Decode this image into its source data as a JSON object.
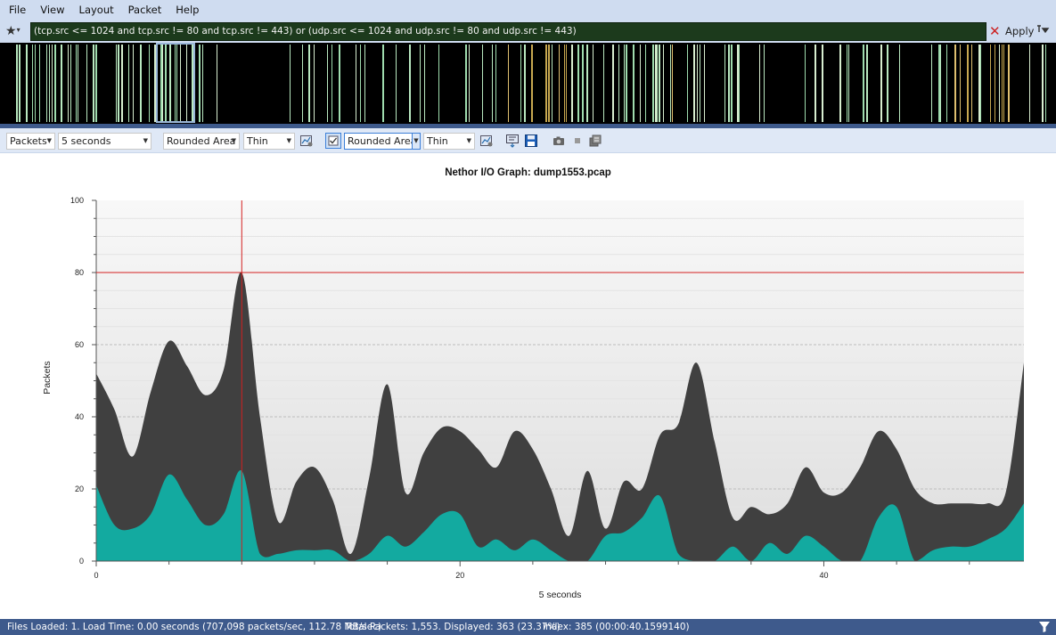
{
  "menu": [
    "File",
    "View",
    "Layout",
    "Packet",
    "Help"
  ],
  "filter": {
    "value": "(tcp.src <= 1024 and tcp.src != 80 and tcp.src != 443) or (udp.src <= 1024 and udp.src != 80 and udp.src != 443)",
    "apply_label": "Apply"
  },
  "toolbar": {
    "units": "Packets",
    "interval": "5 seconds",
    "style1": "Rounded Area",
    "width1": "Thin",
    "style2": "Rounded Area",
    "width2": "Thin"
  },
  "status": {
    "files_loaded": "Files Loaded: 1. Load Time: 0.00 seconds (707,098 packets/sec, 112.78 MB/sec)",
    "total_packets": "Total Packets: 1,553. Displayed: 363 (23.37%)",
    "index": "Index: 385 (00:00:40.1599140)"
  },
  "chart_data": {
    "type": "area",
    "title": "Nethor I/O Graph: dump1553.pcap",
    "xlabel": "5 seconds",
    "ylabel": "Packets",
    "xlim": [
      0,
      51
    ],
    "ylim": [
      0,
      100
    ],
    "x_ticks": [
      0,
      20,
      40
    ],
    "y_ticks": [
      0,
      20,
      40,
      60,
      80,
      100
    ],
    "grid": true,
    "cursor": {
      "x": 8,
      "y": 80
    },
    "series": [
      {
        "color": "#404040",
        "x": [
          0,
          1,
          2,
          3,
          4,
          5,
          6,
          7,
          8,
          9,
          10,
          11,
          12,
          13,
          14,
          15,
          16,
          17,
          18,
          19,
          20,
          21,
          22,
          23,
          24,
          25,
          26,
          27,
          28,
          29,
          30,
          31,
          32,
          33,
          34,
          35,
          36,
          37,
          38,
          39,
          40,
          41,
          42,
          43,
          44,
          45,
          46,
          47,
          48,
          49,
          50,
          51
        ],
        "values": [
          52,
          42,
          29,
          47,
          61,
          54,
          46,
          53,
          80,
          40,
          11,
          22,
          26,
          17,
          2,
          23,
          49,
          19,
          30,
          37,
          36,
          31,
          26,
          36,
          31,
          20,
          7,
          25,
          9,
          22,
          20,
          35,
          38,
          55,
          33,
          12,
          15,
          13,
          16,
          26,
          19,
          19,
          26,
          36,
          31,
          20,
          16,
          16,
          16,
          16,
          19,
          55
        ]
      },
      {
        "color": "#13aaa0",
        "x": [
          0,
          1,
          2,
          3,
          4,
          5,
          6,
          7,
          8,
          9,
          10,
          11,
          12,
          13,
          14,
          15,
          16,
          17,
          18,
          19,
          20,
          21,
          22,
          23,
          24,
          25,
          26,
          27,
          28,
          29,
          30,
          31,
          32,
          33,
          34,
          35,
          36,
          37,
          38,
          39,
          40,
          41,
          42,
          43,
          44,
          45,
          46,
          47,
          48,
          49,
          50,
          51
        ],
        "values": [
          21,
          10,
          9,
          13,
          24,
          17,
          10,
          13,
          25,
          2,
          2,
          3,
          3,
          3,
          0,
          2,
          7,
          4,
          8,
          13,
          13,
          4,
          6,
          3,
          6,
          3,
          0,
          0,
          7,
          8,
          12,
          18,
          2,
          0,
          0,
          4,
          0,
          5,
          2,
          7,
          4,
          0,
          0,
          12,
          15,
          0,
          3,
          4,
          4,
          6,
          9,
          16
        ]
      }
    ]
  }
}
